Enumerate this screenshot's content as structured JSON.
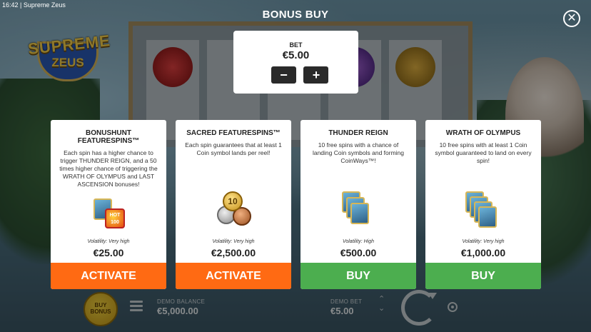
{
  "status_bar": {
    "text": "16:42  | Supreme Zeus"
  },
  "logo": {
    "line1": "SUPREME",
    "line2": "ZEUS"
  },
  "header": {
    "title": "BONUS BUY"
  },
  "bet_panel": {
    "label": "BET",
    "amount": "€5.00",
    "decrease_label": "−",
    "increase_label": "+"
  },
  "cards": [
    {
      "title": "BONUSHUNT FEATURESPINS™",
      "description": "Each spin has a higher chance to trigger THUNDER REIGN, and a 50 times higher chance of triggering the WRATH OF OLYMPUS and LAST ASCENSION bonuses!",
      "art_text": "HOT 100",
      "volatility": "Volatility: Very high",
      "price": "€25.00",
      "action": "ACTIVATE",
      "action_color": "#ff6a13"
    },
    {
      "title": "SACRED FEATURESPINS™",
      "description": "Each spin guarantees that at least 1 Coin symbol lands per reel!",
      "art_text": "10",
      "volatility": "Volatility: Very high",
      "price": "€2,500.00",
      "action": "ACTIVATE",
      "action_color": "#ff6a13"
    },
    {
      "title": "THUNDER REIGN",
      "description": "10 free spins with a chance of landing Coin symbols and forming CoinWays™!",
      "volatility": "Volatility: High",
      "price": "€500.00",
      "action": "BUY",
      "action_color": "#4cae4f"
    },
    {
      "title": "WRATH OF OLYMPUS",
      "description": "10 free spins with at least 1 Coin symbol guaranteed to land on every spin!",
      "volatility": "Volatility: Very high",
      "price": "€1,000.00",
      "action": "BUY",
      "action_color": "#4cae4f"
    }
  ],
  "bottom_bar": {
    "buy_bonus_label": "BUY BONUS",
    "balance_label": "DEMO BALANCE",
    "balance_value": "€5,000.00",
    "bet_label": "DEMO BET",
    "bet_value": "€5.00"
  },
  "colors": {
    "activate": "#ff6a13",
    "buy": "#4cae4f",
    "panel": "#ffffff"
  }
}
